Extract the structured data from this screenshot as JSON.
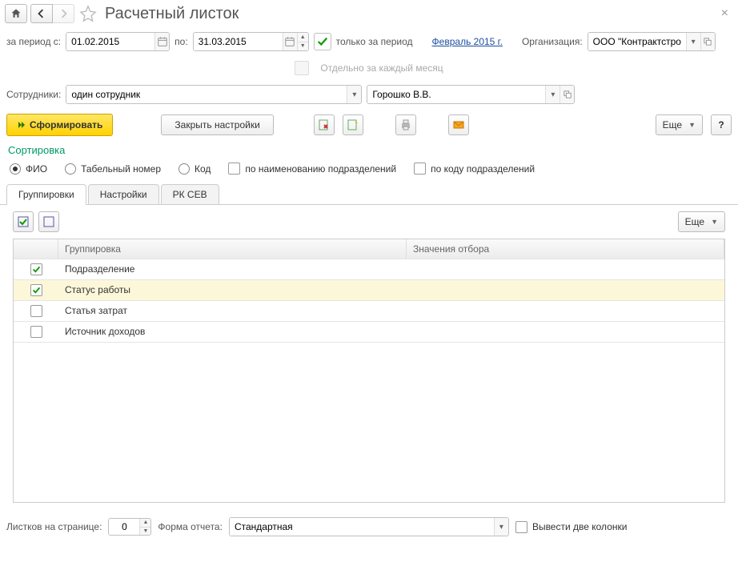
{
  "header": {
    "title": "Расчетный листок"
  },
  "period": {
    "label_from": "за период с:",
    "date_from": "01.02.2015",
    "label_to": "по:",
    "date_to": "31.03.2015",
    "only_period_label": "только за период",
    "only_period_checked": true,
    "period_link": "Февраль 2015 г.",
    "org_label": "Организация:",
    "org_value": "ООО \"Контрактстрой"
  },
  "monthly": {
    "label": "Отдельно за каждый месяц",
    "enabled": false
  },
  "employees": {
    "label": "Сотрудники:",
    "mode": "один сотрудник",
    "value": "Горошко В.В."
  },
  "toolbar": {
    "form_label": "Сформировать",
    "close_settings": "Закрыть настройки",
    "more": "Еще"
  },
  "sort": {
    "title": "Сортировка",
    "options": {
      "fio": "ФИО",
      "tabnum": "Табельный номер",
      "code": "Код"
    },
    "selected": "fio",
    "by_dept_name": "по наименованию подразделений",
    "by_dept_code": "по коду подразделений"
  },
  "tabs": {
    "items": [
      "Группировки",
      "Настройки",
      "РК СЕВ"
    ],
    "active": 0
  },
  "grid": {
    "more": "Еще",
    "columns": [
      "Группировка",
      "Значения отбора"
    ],
    "rows": [
      {
        "checked": true,
        "name": "Подразделение",
        "value": ""
      },
      {
        "checked": true,
        "name": "Статус работы",
        "value": "",
        "selected": true
      },
      {
        "checked": false,
        "name": "Статья затрат",
        "value": ""
      },
      {
        "checked": false,
        "name": "Источник доходов",
        "value": ""
      }
    ]
  },
  "footer": {
    "per_page_label": "Листков на странице:",
    "per_page_value": "0",
    "form_label": "Форма отчета:",
    "form_value": "Стандартная",
    "two_cols_label": "Вывести две колонки"
  }
}
